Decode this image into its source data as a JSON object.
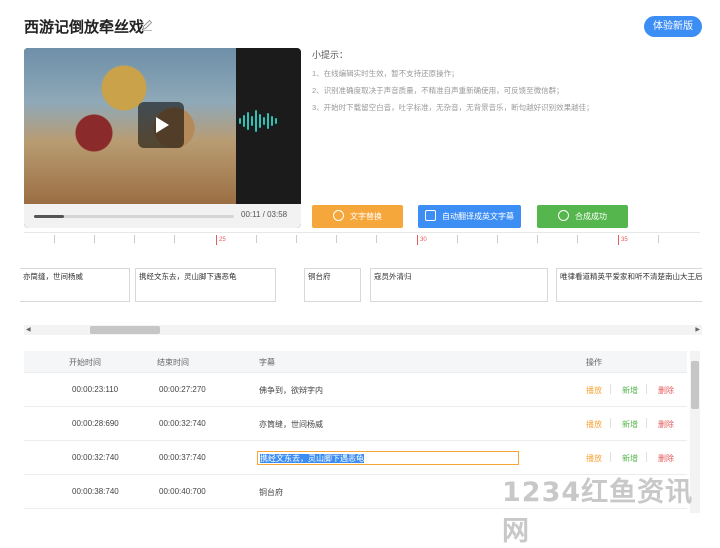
{
  "header": {
    "title": "西游记倒放牵丝戏",
    "upgrade_label": "体验新版"
  },
  "player": {
    "time": "00:11 / 03:58",
    "progress": 0.05
  },
  "tips": {
    "title": "小提示：",
    "items": [
      "1、在线编辑实时生效，暂不支持还原操作；",
      "2、识别准确度取决于声音质量，不精准自声重新确使用，可反馈至微信群；",
      "3、开始时下载留空白音，吐字标准，无杂音，无背景音乐，断句越好识别效果越佳；"
    ]
  },
  "actions": {
    "text_label": "文字替换",
    "translate_label": "自动翻译成英文字幕",
    "compose_label": "合成成功"
  },
  "timeline": {
    "labels": [
      "25",
      "30",
      "35"
    ],
    "blocks": [
      "亦筒缝，世间杨威",
      "携经文东去，灵山脚下遇恶龟",
      "铜台府",
      "寇员外清归",
      "唯律看道精英平爱家和听不清楚南山大王后"
    ]
  },
  "table": {
    "headers": {
      "start": "开始时间",
      "end": "结束时间",
      "subtitle": "字幕",
      "ops": "操作"
    },
    "op_labels": {
      "play": "播放",
      "add": "新增",
      "delete": "删除"
    },
    "rows": [
      {
        "start": "00:00:23:110",
        "end": "00:00:27:270",
        "text": "佛争到，欲辩字内"
      },
      {
        "start": "00:00:28:690",
        "end": "00:00:32:740",
        "text": "亦筒缝，世间杨威"
      },
      {
        "start": "00:00:32:740",
        "end": "00:00:37:740",
        "text": "携经文东去，灵山脚下遇恶龟"
      },
      {
        "start": "00:00:38:740",
        "end": "00:00:40:700",
        "text": "铜台府"
      }
    ]
  },
  "watermark": "1234红鱼资讯网"
}
